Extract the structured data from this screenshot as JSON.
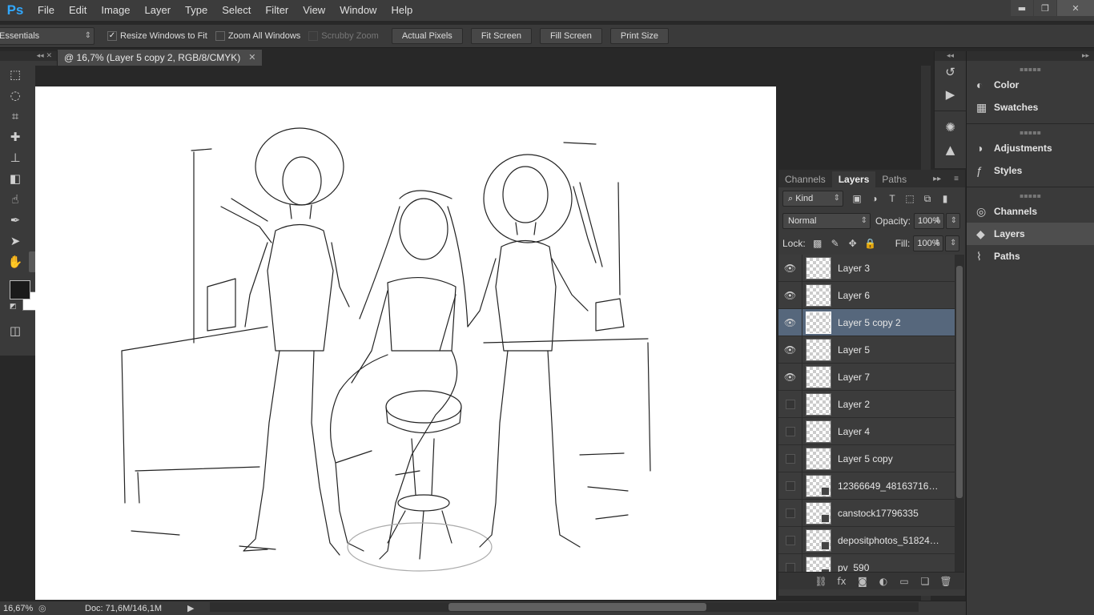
{
  "app": {
    "logo": "Ps"
  },
  "menu": [
    "File",
    "Edit",
    "Image",
    "Layer",
    "Type",
    "Select",
    "Filter",
    "View",
    "Window",
    "Help"
  ],
  "window_controls": {
    "minimize": "▬",
    "restore": "❐",
    "close": "✕"
  },
  "options": {
    "tool_icon": "zoom-icon",
    "resize_windows": {
      "label": "Resize Windows to Fit",
      "checked": true
    },
    "zoom_all": {
      "label": "Zoom All Windows",
      "checked": false
    },
    "scrubby": {
      "label": "Scrubby Zoom",
      "checked": false,
      "disabled": true
    },
    "buttons": [
      "Actual Pixels",
      "Fit Screen",
      "Fill Screen",
      "Print Size"
    ]
  },
  "workspace": "Essentials",
  "document": {
    "tab_title": "@ 16,7% (Layer 5 copy 2, RGB/8/CMYK)",
    "close": "✕"
  },
  "status": {
    "zoom": "16,67%",
    "doc_info": "Doc: 71,6M/146,1M"
  },
  "minidock_icons": [
    "history-icon",
    "actions-icon",
    "adjust-icon",
    "histogram-icon"
  ],
  "right_dock": {
    "groups": [
      [
        {
          "label": "Color",
          "icon": "color-icon"
        },
        {
          "label": "Swatches",
          "icon": "swatches-icon"
        }
      ],
      [
        {
          "label": "Adjustments",
          "icon": "adjustments-icon"
        },
        {
          "label": "Styles",
          "icon": "styles-icon"
        }
      ],
      [
        {
          "label": "Channels",
          "icon": "channels-icon"
        },
        {
          "label": "Layers",
          "icon": "layers-icon",
          "active": true
        },
        {
          "label": "Paths",
          "icon": "paths-icon"
        }
      ]
    ]
  },
  "layers_panel": {
    "tabs": [
      "Channels",
      "Layers",
      "Paths"
    ],
    "active_tab": "Layers",
    "filter_kind": "Kind",
    "blend_mode": "Normal",
    "opacity_label": "Opacity:",
    "opacity": "100%",
    "lock_label": "Lock:",
    "fill_label": "Fill:",
    "fill": "100%",
    "layers": [
      {
        "name": "Layer 3",
        "visible": true,
        "selected": false,
        "smart": false
      },
      {
        "name": "Layer 6",
        "visible": true,
        "selected": false,
        "smart": false
      },
      {
        "name": "Layer 5 copy 2",
        "visible": true,
        "selected": true,
        "smart": false
      },
      {
        "name": "Layer 5",
        "visible": true,
        "selected": false,
        "smart": false
      },
      {
        "name": "Layer 7",
        "visible": true,
        "selected": false,
        "smart": false
      },
      {
        "name": "Layer 2",
        "visible": false,
        "selected": false,
        "smart": false
      },
      {
        "name": "Layer 4",
        "visible": false,
        "selected": false,
        "smart": false
      },
      {
        "name": "Layer 5 copy",
        "visible": false,
        "selected": false,
        "smart": false
      },
      {
        "name": "12366649_4816371686...",
        "visible": false,
        "selected": false,
        "smart": true
      },
      {
        "name": "canstock17796335",
        "visible": false,
        "selected": false,
        "smart": true
      },
      {
        "name": "depositphotos_518244...",
        "visible": false,
        "selected": false,
        "smart": true
      },
      {
        "name": "pv_590",
        "visible": false,
        "selected": false,
        "smart": true
      }
    ]
  },
  "colors": {
    "foreground": "#1a1a1a",
    "background": "#ffffff",
    "selected_layer": "#56677c",
    "accent": "#31a8ff"
  }
}
